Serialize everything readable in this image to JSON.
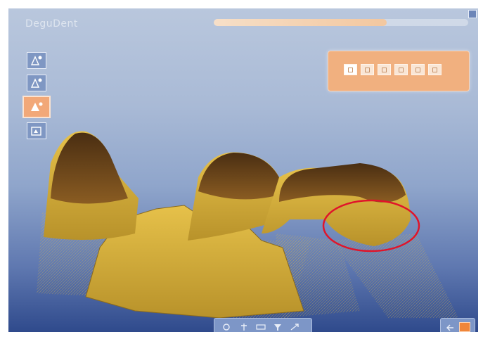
{
  "window": {
    "title": "DeguDent"
  },
  "progress": {
    "value": 0.68
  },
  "left_toolbar": {
    "tools": [
      {
        "name": "view-tool-1-icon"
      },
      {
        "name": "view-tool-2-icon"
      },
      {
        "name": "view-tool-3-icon",
        "active": true
      },
      {
        "name": "view-tool-4-icon"
      }
    ]
  },
  "view_panel": {
    "buttons": [
      {
        "name": "panel-button-1",
        "active": true
      },
      {
        "name": "panel-button-2"
      },
      {
        "name": "panel-button-3"
      },
      {
        "name": "panel-button-4"
      },
      {
        "name": "panel-button-5"
      },
      {
        "name": "panel-button-6"
      }
    ]
  },
  "bottom_toolbar": {
    "buttons": [
      "zoom-icon",
      "pin-icon",
      "grid-icon",
      "filter-icon",
      "resize-icon"
    ]
  },
  "corner_buttons": [
    "back-icon",
    "orange-stop-icon"
  ],
  "colors": {
    "background_top": "#b9c7dd",
    "background_bottom": "#2f4a8c",
    "model_gold": "#d8b23a",
    "model_brown": "#6b4518",
    "highlight_circle": "#e0142a",
    "accent_orange": "#f1b07f"
  }
}
